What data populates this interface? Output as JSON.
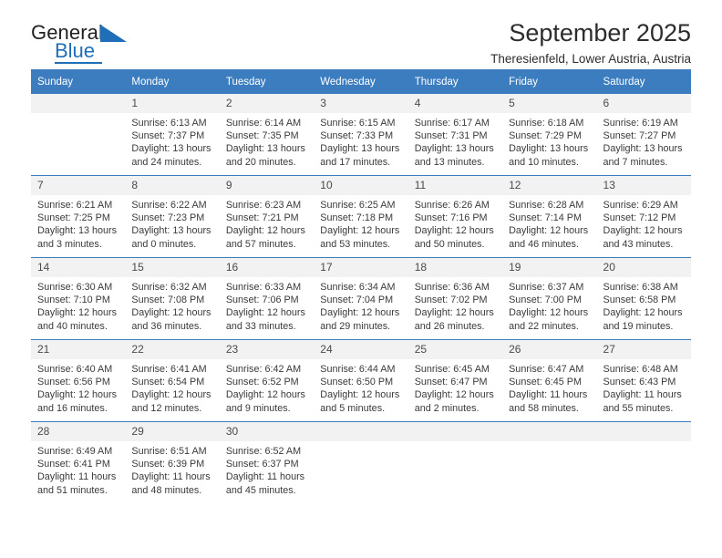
{
  "brand": {
    "name_top": "General",
    "name_bottom": "Blue",
    "accent_color": "#1f6fb8"
  },
  "header": {
    "title": "September 2025",
    "subtitle": "Theresienfeld, Lower Austria, Austria"
  },
  "calendar": {
    "header_color": "#3b7dbf",
    "weekdays": [
      "Sunday",
      "Monday",
      "Tuesday",
      "Wednesday",
      "Thursday",
      "Friday",
      "Saturday"
    ],
    "weeks": [
      [
        {
          "day": "",
          "sunrise": "",
          "sunset": "",
          "daylight_line1": "",
          "daylight_line2": ""
        },
        {
          "day": "1",
          "sunrise": "Sunrise: 6:13 AM",
          "sunset": "Sunset: 7:37 PM",
          "daylight_line1": "Daylight: 13 hours",
          "daylight_line2": "and 24 minutes."
        },
        {
          "day": "2",
          "sunrise": "Sunrise: 6:14 AM",
          "sunset": "Sunset: 7:35 PM",
          "daylight_line1": "Daylight: 13 hours",
          "daylight_line2": "and 20 minutes."
        },
        {
          "day": "3",
          "sunrise": "Sunrise: 6:15 AM",
          "sunset": "Sunset: 7:33 PM",
          "daylight_line1": "Daylight: 13 hours",
          "daylight_line2": "and 17 minutes."
        },
        {
          "day": "4",
          "sunrise": "Sunrise: 6:17 AM",
          "sunset": "Sunset: 7:31 PM",
          "daylight_line1": "Daylight: 13 hours",
          "daylight_line2": "and 13 minutes."
        },
        {
          "day": "5",
          "sunrise": "Sunrise: 6:18 AM",
          "sunset": "Sunset: 7:29 PM",
          "daylight_line1": "Daylight: 13 hours",
          "daylight_line2": "and 10 minutes."
        },
        {
          "day": "6",
          "sunrise": "Sunrise: 6:19 AM",
          "sunset": "Sunset: 7:27 PM",
          "daylight_line1": "Daylight: 13 hours",
          "daylight_line2": "and 7 minutes."
        }
      ],
      [
        {
          "day": "7",
          "sunrise": "Sunrise: 6:21 AM",
          "sunset": "Sunset: 7:25 PM",
          "daylight_line1": "Daylight: 13 hours",
          "daylight_line2": "and 3 minutes."
        },
        {
          "day": "8",
          "sunrise": "Sunrise: 6:22 AM",
          "sunset": "Sunset: 7:23 PM",
          "daylight_line1": "Daylight: 13 hours",
          "daylight_line2": "and 0 minutes."
        },
        {
          "day": "9",
          "sunrise": "Sunrise: 6:23 AM",
          "sunset": "Sunset: 7:21 PM",
          "daylight_line1": "Daylight: 12 hours",
          "daylight_line2": "and 57 minutes."
        },
        {
          "day": "10",
          "sunrise": "Sunrise: 6:25 AM",
          "sunset": "Sunset: 7:18 PM",
          "daylight_line1": "Daylight: 12 hours",
          "daylight_line2": "and 53 minutes."
        },
        {
          "day": "11",
          "sunrise": "Sunrise: 6:26 AM",
          "sunset": "Sunset: 7:16 PM",
          "daylight_line1": "Daylight: 12 hours",
          "daylight_line2": "and 50 minutes."
        },
        {
          "day": "12",
          "sunrise": "Sunrise: 6:28 AM",
          "sunset": "Sunset: 7:14 PM",
          "daylight_line1": "Daylight: 12 hours",
          "daylight_line2": "and 46 minutes."
        },
        {
          "day": "13",
          "sunrise": "Sunrise: 6:29 AM",
          "sunset": "Sunset: 7:12 PM",
          "daylight_line1": "Daylight: 12 hours",
          "daylight_line2": "and 43 minutes."
        }
      ],
      [
        {
          "day": "14",
          "sunrise": "Sunrise: 6:30 AM",
          "sunset": "Sunset: 7:10 PM",
          "daylight_line1": "Daylight: 12 hours",
          "daylight_line2": "and 40 minutes."
        },
        {
          "day": "15",
          "sunrise": "Sunrise: 6:32 AM",
          "sunset": "Sunset: 7:08 PM",
          "daylight_line1": "Daylight: 12 hours",
          "daylight_line2": "and 36 minutes."
        },
        {
          "day": "16",
          "sunrise": "Sunrise: 6:33 AM",
          "sunset": "Sunset: 7:06 PM",
          "daylight_line1": "Daylight: 12 hours",
          "daylight_line2": "and 33 minutes."
        },
        {
          "day": "17",
          "sunrise": "Sunrise: 6:34 AM",
          "sunset": "Sunset: 7:04 PM",
          "daylight_line1": "Daylight: 12 hours",
          "daylight_line2": "and 29 minutes."
        },
        {
          "day": "18",
          "sunrise": "Sunrise: 6:36 AM",
          "sunset": "Sunset: 7:02 PM",
          "daylight_line1": "Daylight: 12 hours",
          "daylight_line2": "and 26 minutes."
        },
        {
          "day": "19",
          "sunrise": "Sunrise: 6:37 AM",
          "sunset": "Sunset: 7:00 PM",
          "daylight_line1": "Daylight: 12 hours",
          "daylight_line2": "and 22 minutes."
        },
        {
          "day": "20",
          "sunrise": "Sunrise: 6:38 AM",
          "sunset": "Sunset: 6:58 PM",
          "daylight_line1": "Daylight: 12 hours",
          "daylight_line2": "and 19 minutes."
        }
      ],
      [
        {
          "day": "21",
          "sunrise": "Sunrise: 6:40 AM",
          "sunset": "Sunset: 6:56 PM",
          "daylight_line1": "Daylight: 12 hours",
          "daylight_line2": "and 16 minutes."
        },
        {
          "day": "22",
          "sunrise": "Sunrise: 6:41 AM",
          "sunset": "Sunset: 6:54 PM",
          "daylight_line1": "Daylight: 12 hours",
          "daylight_line2": "and 12 minutes."
        },
        {
          "day": "23",
          "sunrise": "Sunrise: 6:42 AM",
          "sunset": "Sunset: 6:52 PM",
          "daylight_line1": "Daylight: 12 hours",
          "daylight_line2": "and 9 minutes."
        },
        {
          "day": "24",
          "sunrise": "Sunrise: 6:44 AM",
          "sunset": "Sunset: 6:50 PM",
          "daylight_line1": "Daylight: 12 hours",
          "daylight_line2": "and 5 minutes."
        },
        {
          "day": "25",
          "sunrise": "Sunrise: 6:45 AM",
          "sunset": "Sunset: 6:47 PM",
          "daylight_line1": "Daylight: 12 hours",
          "daylight_line2": "and 2 minutes."
        },
        {
          "day": "26",
          "sunrise": "Sunrise: 6:47 AM",
          "sunset": "Sunset: 6:45 PM",
          "daylight_line1": "Daylight: 11 hours",
          "daylight_line2": "and 58 minutes."
        },
        {
          "day": "27",
          "sunrise": "Sunrise: 6:48 AM",
          "sunset": "Sunset: 6:43 PM",
          "daylight_line1": "Daylight: 11 hours",
          "daylight_line2": "and 55 minutes."
        }
      ],
      [
        {
          "day": "28",
          "sunrise": "Sunrise: 6:49 AM",
          "sunset": "Sunset: 6:41 PM",
          "daylight_line1": "Daylight: 11 hours",
          "daylight_line2": "and 51 minutes."
        },
        {
          "day": "29",
          "sunrise": "Sunrise: 6:51 AM",
          "sunset": "Sunset: 6:39 PM",
          "daylight_line1": "Daylight: 11 hours",
          "daylight_line2": "and 48 minutes."
        },
        {
          "day": "30",
          "sunrise": "Sunrise: 6:52 AM",
          "sunset": "Sunset: 6:37 PM",
          "daylight_line1": "Daylight: 11 hours",
          "daylight_line2": "and 45 minutes."
        },
        {
          "day": "",
          "sunrise": "",
          "sunset": "",
          "daylight_line1": "",
          "daylight_line2": ""
        },
        {
          "day": "",
          "sunrise": "",
          "sunset": "",
          "daylight_line1": "",
          "daylight_line2": ""
        },
        {
          "day": "",
          "sunrise": "",
          "sunset": "",
          "daylight_line1": "",
          "daylight_line2": ""
        },
        {
          "day": "",
          "sunrise": "",
          "sunset": "",
          "daylight_line1": "",
          "daylight_line2": ""
        }
      ]
    ]
  }
}
